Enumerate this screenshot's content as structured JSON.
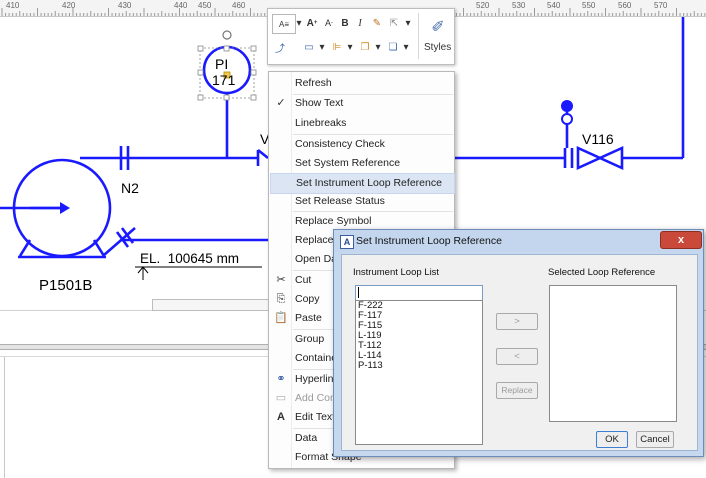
{
  "ruler": {
    "ticks": [
      "410",
      "420",
      "430",
      "440",
      "450",
      "460",
      "520",
      "530",
      "540",
      "550",
      "560",
      "570"
    ]
  },
  "toolbar": {
    "styles_label": "Styles",
    "bold_label": "B",
    "italic_label": "I",
    "grow_font_label": "A",
    "shrink_font_label": "A"
  },
  "diagram": {
    "instrument_tag_line1": "PI",
    "instrument_tag_line2": "171",
    "valve_label_right": "V116",
    "valve_label_left_partial": "V",
    "nozzle_label": "N2",
    "pump_label": "P1501B",
    "elevation_label": "EL.  100645 mm",
    "cut_text": "...."
  },
  "context_menu": {
    "items": [
      {
        "label": "Refresh"
      },
      {
        "label": "Show Text"
      },
      {
        "label": "Linebreaks"
      },
      {
        "label": "Consistency Check"
      },
      {
        "label": "Set System Reference"
      },
      {
        "label": "Set Instrument Loop Reference"
      },
      {
        "label": "Set Release Status"
      },
      {
        "label": "Replace Symbol"
      },
      {
        "label": "Replace s"
      },
      {
        "label": "Open Dat"
      },
      {
        "label": "Cut"
      },
      {
        "label": "Copy"
      },
      {
        "label": "Paste"
      },
      {
        "label": "Group"
      },
      {
        "label": "Containe"
      },
      {
        "label": "Hyperlink"
      },
      {
        "label": "Add Com"
      },
      {
        "label": "Edit Text"
      },
      {
        "label": "Data"
      },
      {
        "label": "Format Shape"
      }
    ]
  },
  "dialog": {
    "title": "Set Instrument Loop Reference",
    "close_symbol": "x",
    "instrument_loop_list_label": "Instrument Loop List",
    "selected_loop_reference_label": "Selected Loop Reference",
    "search_value": "",
    "loops": [
      "F-222",
      "F-117",
      "F-115",
      "L-119",
      "T-112",
      "L-114",
      "P-113"
    ],
    "add_button": ">",
    "remove_button": "<",
    "replace_button": "Replace",
    "ok_button": "OK",
    "cancel_button": "Cancel"
  },
  "colors": {
    "diagram_line": "#1a1aff",
    "menu_highlight": "#dbe5f3",
    "dialog_frame": "#c6d8ee"
  }
}
